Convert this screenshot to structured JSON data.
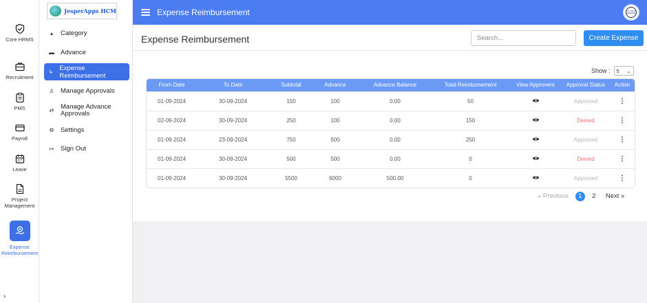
{
  "rail": {
    "items": [
      {
        "label": "Core HRMS",
        "icon": "shield-check-icon"
      },
      {
        "label": "Recruitment",
        "icon": "briefcase-icon"
      },
      {
        "label": "PMS",
        "icon": "clipboard-icon"
      },
      {
        "label": "Payroll",
        "icon": "credit-card-icon"
      },
      {
        "label": "Leave",
        "icon": "calendar-icon"
      },
      {
        "label": "Project Management",
        "icon": "document-icon"
      },
      {
        "label": "Expense Reimbursement",
        "icon": "hand-coin-icon",
        "active": true
      }
    ],
    "collapse_toggle": "›"
  },
  "brand": {
    "name": "JesperApps HCM"
  },
  "sidebar": {
    "items": [
      {
        "label": "Category",
        "icon": "category-icon"
      },
      {
        "label": "Advance",
        "icon": "wallet-icon"
      },
      {
        "label": "Expense Reimbursement",
        "icon": "receipt-icon",
        "active": true
      },
      {
        "label": "Manage Approvals",
        "icon": "user-check-icon"
      },
      {
        "label": "Manage Advance Approvals",
        "icon": "exchange-icon"
      },
      {
        "label": "Settings",
        "icon": "gear-icon"
      },
      {
        "label": "Sign Out",
        "icon": "logout-icon"
      }
    ]
  },
  "header": {
    "title": "Expense Reimbursement",
    "avatar_text": "AT YOUR SERVICE"
  },
  "main": {
    "title": "Expense Reimbursement",
    "search": {
      "placeholder": "Search..."
    },
    "create_button": "Create Expense",
    "show_label": "Show :",
    "show_value": "5"
  },
  "table": {
    "columns": [
      "From Date",
      "To Date",
      "Subtotal",
      "Advance",
      "Advance Balance",
      "Total Reimbursement",
      "View Approvers",
      "Approval  Status",
      "Action"
    ],
    "rows": [
      {
        "from": "01-09-2024",
        "to": "30-09-2024",
        "subtotal": "150",
        "advance": "100",
        "balance": "0.00",
        "total": "50",
        "status": "Approved"
      },
      {
        "from": "02-09-2024",
        "to": "30-09-2024",
        "subtotal": "250",
        "advance": "100",
        "balance": "0.00",
        "total": "150",
        "status": "Denied"
      },
      {
        "from": "01-09-2024",
        "to": "23-09-2024",
        "subtotal": "750",
        "advance": "500",
        "balance": "0.00",
        "total": "250",
        "status": "Approved"
      },
      {
        "from": "01-09-2024",
        "to": "30-09-2024",
        "subtotal": "500",
        "advance": "500",
        "balance": "0.00",
        "total": "0",
        "status": "Denied"
      },
      {
        "from": "01-09-2024",
        "to": "30-09-2024",
        "subtotal": "5500",
        "advance": "6000",
        "balance": "500.00",
        "total": "0",
        "status": "Approved"
      }
    ]
  },
  "pagination": {
    "previous": "« Previous",
    "pages": [
      "1",
      "2"
    ],
    "current": "1",
    "next": "Next »"
  },
  "colors": {
    "primary": "#4b7cf0",
    "table_header": "#6a9af4",
    "button": "#2f8ef0",
    "denied": "#f07373",
    "approved": "#b7b7b7"
  }
}
